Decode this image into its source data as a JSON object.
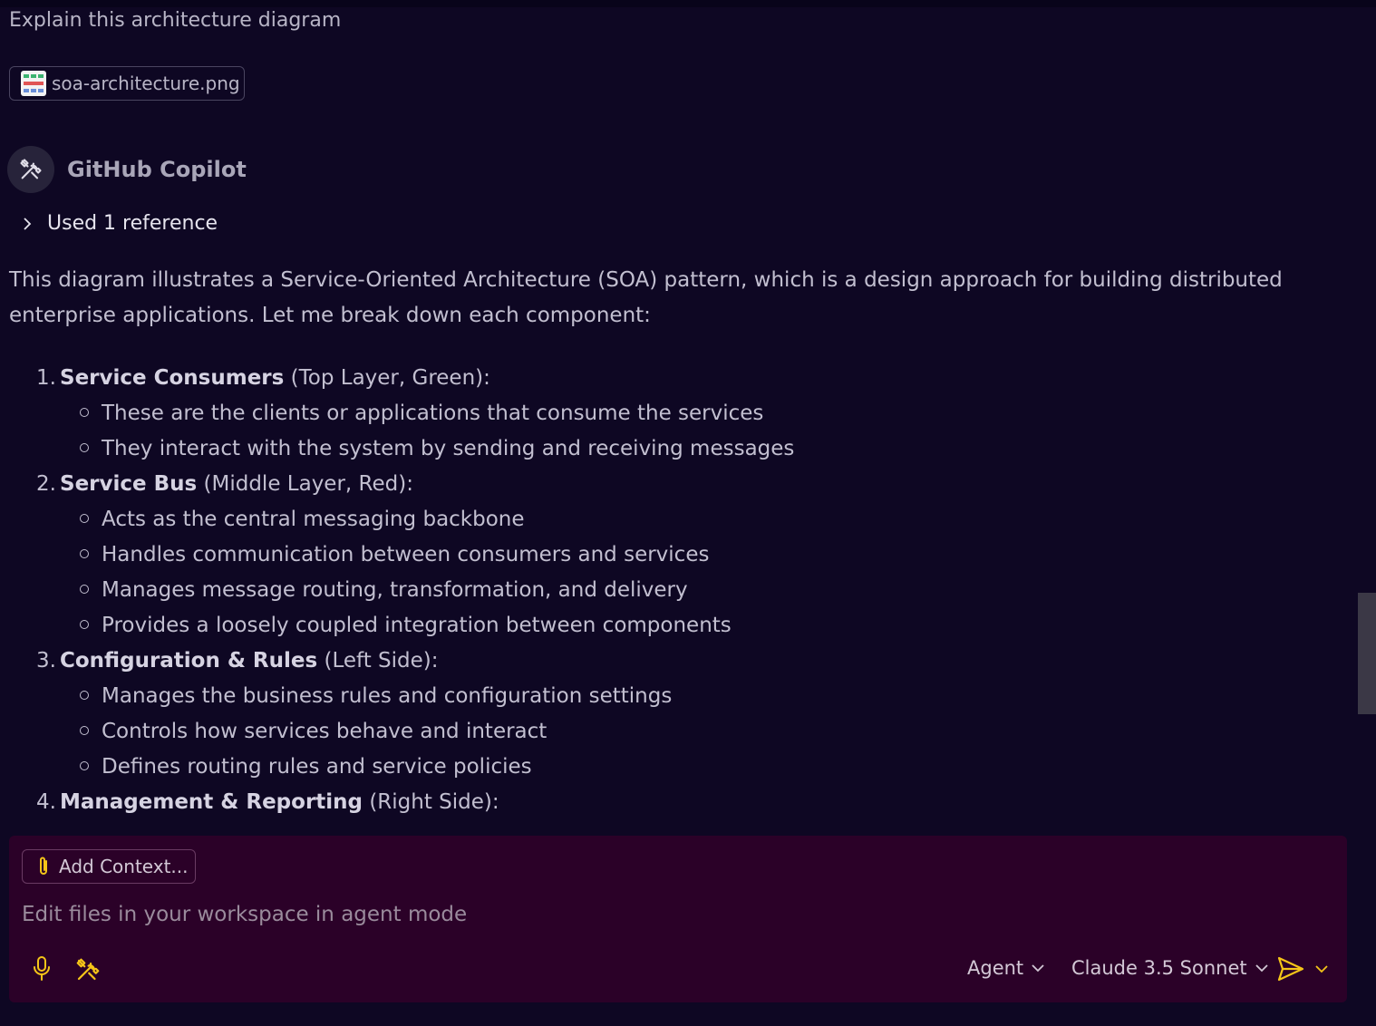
{
  "user_message": "Explain this architecture diagram",
  "attachment": {
    "filename": "soa-architecture.png",
    "icon": "image-thumbnail-icon"
  },
  "assistant": {
    "name": "GitHub Copilot",
    "icon": "tools-icon"
  },
  "references": {
    "label": "Used 1 reference",
    "icon": "chevron-right-icon"
  },
  "response": {
    "intro": "This diagram illustrates a Service-Oriented Architecture (SOA) pattern, which is a design approach for building distributed enterprise applications. Let me break down each component:",
    "sections": [
      {
        "number": "1.",
        "title": "Service Consumers",
        "note": " (Top Layer, Green):",
        "bullets": [
          "These are the clients or applications that consume the services",
          "They interact with the system by sending and receiving messages"
        ]
      },
      {
        "number": "2.",
        "title": "Service Bus",
        "note": " (Middle Layer, Red):",
        "bullets": [
          "Acts as the central messaging backbone",
          "Handles communication between consumers and services",
          "Manages message routing, transformation, and delivery",
          "Provides a loosely coupled integration between components"
        ]
      },
      {
        "number": "3.",
        "title": "Configuration & Rules",
        "note": " (Left Side):",
        "bullets": [
          "Manages the business rules and configuration settings",
          "Controls how services behave and interact",
          "Defines routing rules and service policies"
        ]
      },
      {
        "number": "4.",
        "title": "Management & Reporting",
        "note": " (Right Side):",
        "bullets": []
      }
    ]
  },
  "input": {
    "add_context_label": "Add Context...",
    "placeholder": "Edit files in your workspace in agent mode",
    "mode_label": "Agent",
    "model_label": "Claude 3.5 Sonnet",
    "icons": [
      "paperclip-icon",
      "microphone-icon",
      "tools-icon",
      "send-icon",
      "chevron-down-icon"
    ]
  },
  "colors": {
    "background": "#0e0723",
    "input_panel": "#2b0128",
    "accent_yellow": "#f5c518"
  }
}
